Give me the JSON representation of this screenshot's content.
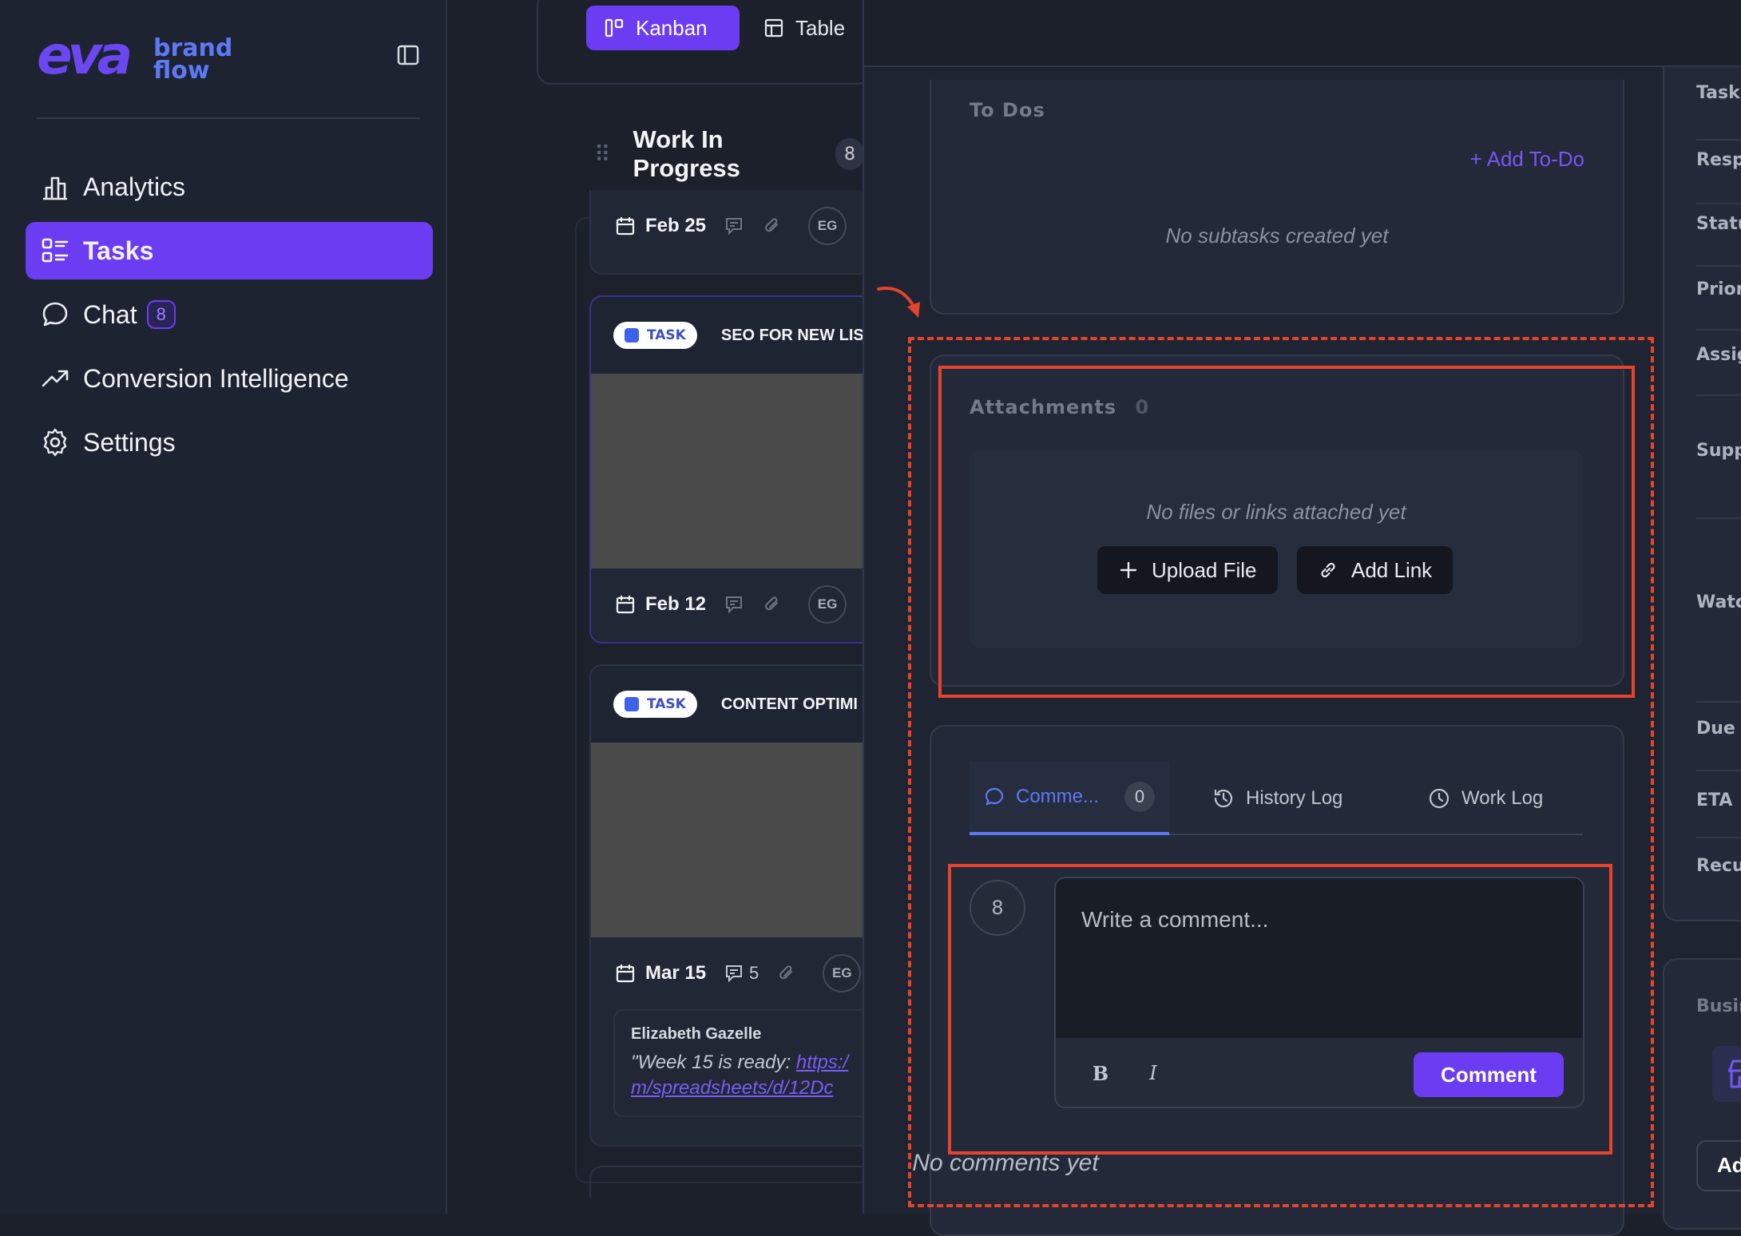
{
  "brand": {
    "logo_mark": "eva",
    "word1": "brand",
    "word2": "flow"
  },
  "sidebar": {
    "items": [
      {
        "label": "Analytics",
        "icon": "bar-chart-icon",
        "active": false
      },
      {
        "label": "Tasks",
        "icon": "task-list-icon",
        "active": true
      },
      {
        "label": "Chat",
        "icon": "chat-bubble-icon",
        "active": false,
        "badge": "8"
      },
      {
        "label": "Conversion Intelligence",
        "icon": "trend-up-icon",
        "active": false
      },
      {
        "label": "Settings",
        "icon": "gear-icon",
        "active": false
      }
    ]
  },
  "board": {
    "views": {
      "kanban": "Kanban",
      "table": "Table"
    },
    "column": {
      "title": "Work In Progress",
      "count": "8"
    },
    "cards": [
      {
        "date": "Feb 25",
        "assignee": "EG"
      },
      {
        "tag": "TASK",
        "title": "SEO FOR NEW LIST",
        "date": "Feb 12",
        "assignee": "EG"
      },
      {
        "tag": "TASK",
        "title": "CONTENT OPTIMI",
        "date": "Mar 15",
        "comments": "5",
        "assignee": "EG",
        "comment_author": "Elizabeth Gazelle",
        "comment_text": "\"Week 15 is ready: ",
        "comment_link1": "https:/",
        "comment_link2": "m/spreadsheets/d/12Dc"
      }
    ]
  },
  "panel": {
    "todos": {
      "title": "To Dos",
      "add_label": "+ Add To-Do",
      "empty": "No subtasks created yet"
    },
    "attachments": {
      "title": "Attachments",
      "count": "0",
      "empty": "No files or links attached yet",
      "upload_label": "Upload File",
      "link_label": "Add Link"
    },
    "tabs": {
      "comments": {
        "label": "Comme...",
        "count": "0"
      },
      "history": {
        "label": "History Log"
      },
      "worklog": {
        "label": "Work Log"
      }
    },
    "comment": {
      "avatar": "8",
      "placeholder": "Write a comment...",
      "bold": "B",
      "italic": "I",
      "submit_label": "Comment",
      "empty": "No comments yet"
    },
    "properties": [
      "Task",
      "Respo",
      "Statu",
      "Priori",
      "Assig",
      "Supp",
      "Watc",
      "Due D",
      "ETA",
      "Recur"
    ],
    "business": {
      "title": "Busin",
      "add_label": "Ad"
    }
  },
  "colors": {
    "accent": "#6b3cf2",
    "link_blue": "#5d78f6",
    "annotation": "#e5432c"
  }
}
